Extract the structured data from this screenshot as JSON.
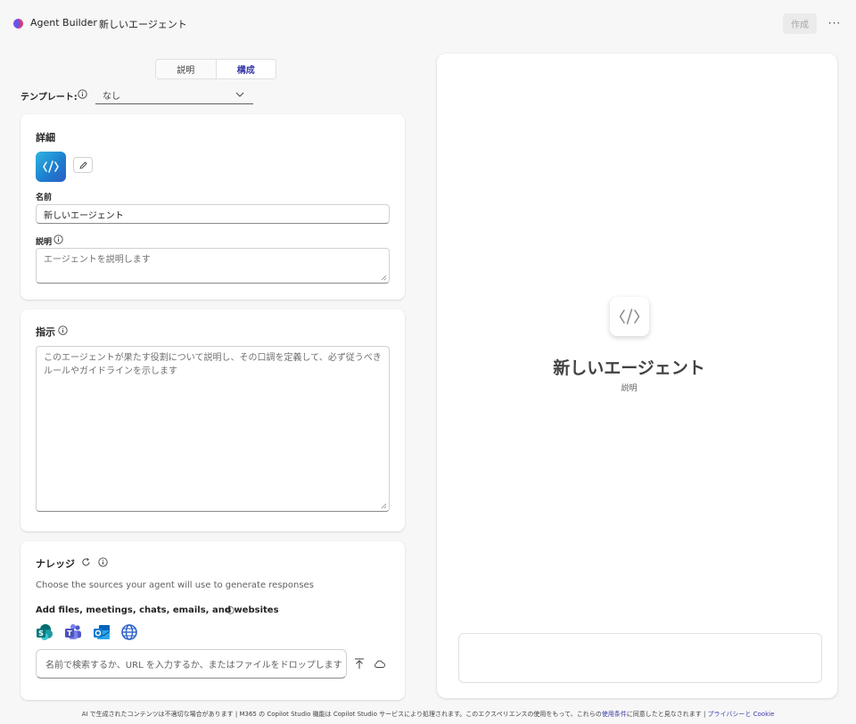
{
  "header": {
    "app_name": "Agent Builder",
    "separator": "›",
    "page_title": "新しいエージェント",
    "create_label": "作成",
    "more_label": "···"
  },
  "tabs": [
    {
      "label": "説明",
      "active": false
    },
    {
      "label": "構成",
      "active": true
    }
  ],
  "template": {
    "label": "テンプレート:",
    "value": "なし"
  },
  "details": {
    "title": "詳細",
    "name_label": "名前",
    "name_value": "新しいエージェント",
    "description_label": "説明",
    "description_placeholder": "エージェントを説明します"
  },
  "instructions": {
    "title": "指示",
    "placeholder_line1": "このエージェントが果たす役割について説明し、その口調を定義して、必ず従うべき",
    "placeholder_line2": "ルールやガイドラインを示します"
  },
  "knowledge": {
    "title": "ナレッジ",
    "description": "Choose the sources your agent will use to generate responses",
    "add_label": "Add files, meetings, chats, emails, and websites",
    "sources": [
      "sharepoint-icon",
      "teams-icon",
      "outlook-icon",
      "web-icon"
    ],
    "search_placeholder": "名前で検索するか、URL を入力するか、またはファイルをドロップします"
  },
  "preview": {
    "agent_name": "新しいエージェント",
    "agent_description": "説明"
  },
  "footer": {
    "text_before": "AI で生成されたコンテンツは不適切な場合があります | M365 の Copilot Studio 機能は Copilot Studio サービスにより処理されます。このエクスペリエンスの使用をもって、これらの",
    "terms_link": "使用条件",
    "text_middle": "に同意したと見なされます | ",
    "privacy_link": "プライバシーと Cookie"
  },
  "colors": {
    "accent": "#3b3ba8",
    "agent_icon_start": "#2fb6e0",
    "agent_icon_end": "#2a5ec4"
  }
}
